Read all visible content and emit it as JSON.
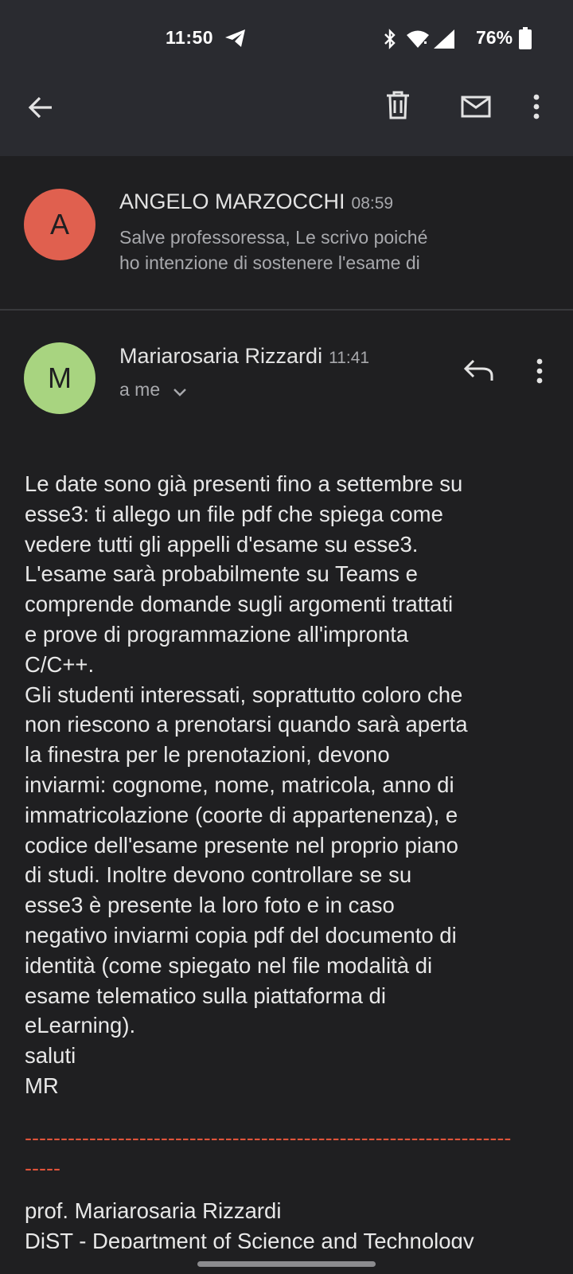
{
  "status_bar": {
    "time": "11:50",
    "battery": "76%"
  },
  "colors": {
    "avatar_a": "#e0604f",
    "avatar_m": "#a8d480",
    "signature_divider": "#e0533a"
  },
  "toolbar": {
    "icons": [
      "back-arrow-icon",
      "trash-icon",
      "mail-icon",
      "more-vert-icon"
    ]
  },
  "messages": [
    {
      "avatar_letter": "A",
      "sender": "ANGELO MARZOCCHI",
      "time": "08:59",
      "snippet_line1": "Salve professoressa, Le scrivo poiché",
      "snippet_line2": "ho intenzione di sostenere l'esame di"
    },
    {
      "avatar_letter": "M",
      "sender": "Mariarosaria Rizzardi",
      "time": "11:41",
      "recipient": "a me",
      "body": "Le date sono già presenti fino a settembre su\nesse3: ti allego un file pdf che spiega come\nvedere tutti gli appelli d'esame su esse3.\nL'esame sarà probabilmente su Teams e\ncomprende domande sugli argomenti trattati\ne prove di programmazione all'impronta\nC/C++.\nGli studenti interessati, soprattutto coloro che\nnon riescono a prenotarsi quando sarà aperta\nla finestra per le prenotazioni, devono\ninviarmi: cognome, nome, matricola, anno di\nimmatricolazione (coorte di appartenenza), e\ncodice dell'esame presente nel proprio piano\ndi studi. Inoltre devono controllare se su\nesse3 è presente la loro foto e in caso\nnegativo inviarmi copia pdf del documento di\nidentità (come spiegato nel file modalità di\nesame telematico sulla piattaforma di\neLearning).\nsaluti\nMR",
      "divider": "--------------------------------------------------------------------\n-----",
      "signature": "prof. Mariarosaria Rizzardi\nDiST - Department of Science and Technology"
    }
  ]
}
